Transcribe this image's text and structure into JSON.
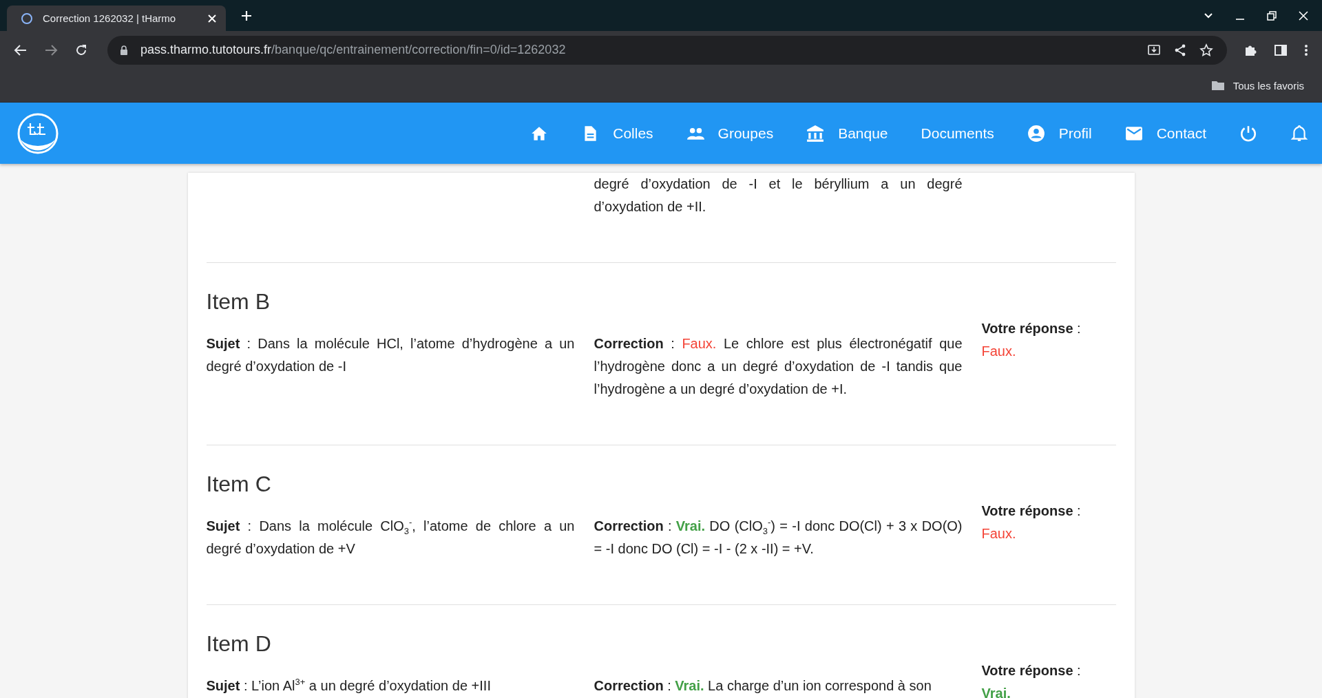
{
  "browser": {
    "tab": {
      "title": "Correction 1262032 | tHarmo"
    },
    "url": {
      "host": "pass.tharmo.tutotours.fr",
      "path": "/banque/qc/entrainement/correction/fin=0/id=1262032"
    },
    "bookmarks": [
      {
        "label": "Tous les favoris"
      }
    ]
  },
  "nav": {
    "items": [
      {
        "kind": "home"
      },
      {
        "kind": "document",
        "label": "Colles"
      },
      {
        "kind": "group",
        "label": "Groupes"
      },
      {
        "kind": "bank",
        "label": "Banque"
      },
      {
        "kind": "text",
        "label": "Documents"
      },
      {
        "kind": "account",
        "label": "Profil"
      },
      {
        "kind": "mail",
        "label": "Contact"
      },
      {
        "kind": "power"
      },
      {
        "kind": "bell"
      }
    ]
  },
  "items": [
    {
      "correction": {
        "text": "degré d’oxydation de -I et le béryllium a un degré d’oxydation de +II."
      }
    },
    {
      "title": "Item B",
      "sujet": "**Sujet** : Dans la molécule HCl, l’atome d’hydrogène a un degré d’oxydation de -I",
      "correction": {
        "lead": "**Correction** :",
        "correct": false,
        "verdict_text": "Faux.",
        "text": "Le chlore est plus électronégatif que l’hydrogène donc a un degré d’oxydation de -I tandis que l’hydrogène a un degré d’oxydation de +I."
      },
      "reponse": {
        "lead": "**Votre réponse** :",
        "correct": false,
        "verdict_text": "Faux."
      }
    },
    {
      "title": "Item C",
      "sujet": "**Sujet** : Dans la molécule ClO$_{3}$$^{-}$, l’atome de chlore a un degré d’oxydation de +V",
      "correction": {
        "lead": "**Correction** :",
        "correct": true,
        "verdict_text": "Vrai.",
        "text": "DO (ClO$_{3}$$^{-}$)  = -I donc DO(Cl) + 3 x DO(O) = -I donc DO (Cl) = -I - (2 x -II) = +V."
      },
      "reponse": {
        "lead": "**Votre réponse** :",
        "correct": false,
        "verdict_text": "Faux."
      }
    },
    {
      "title": "Item D",
      "sujet": "**Sujet** : L’ion Al$^{3+}$ a un degré d’oxydation de +III",
      "correction": {
        "lead": "**Correction** :",
        "correct": true,
        "verdict_text": "Vrai.",
        "text": "La charge d’un ion correspond à son"
      },
      "reponse": {
        "lead": "**Votre réponse** :",
        "correct": true,
        "verdict_text": "Vrai."
      }
    }
  ]
}
